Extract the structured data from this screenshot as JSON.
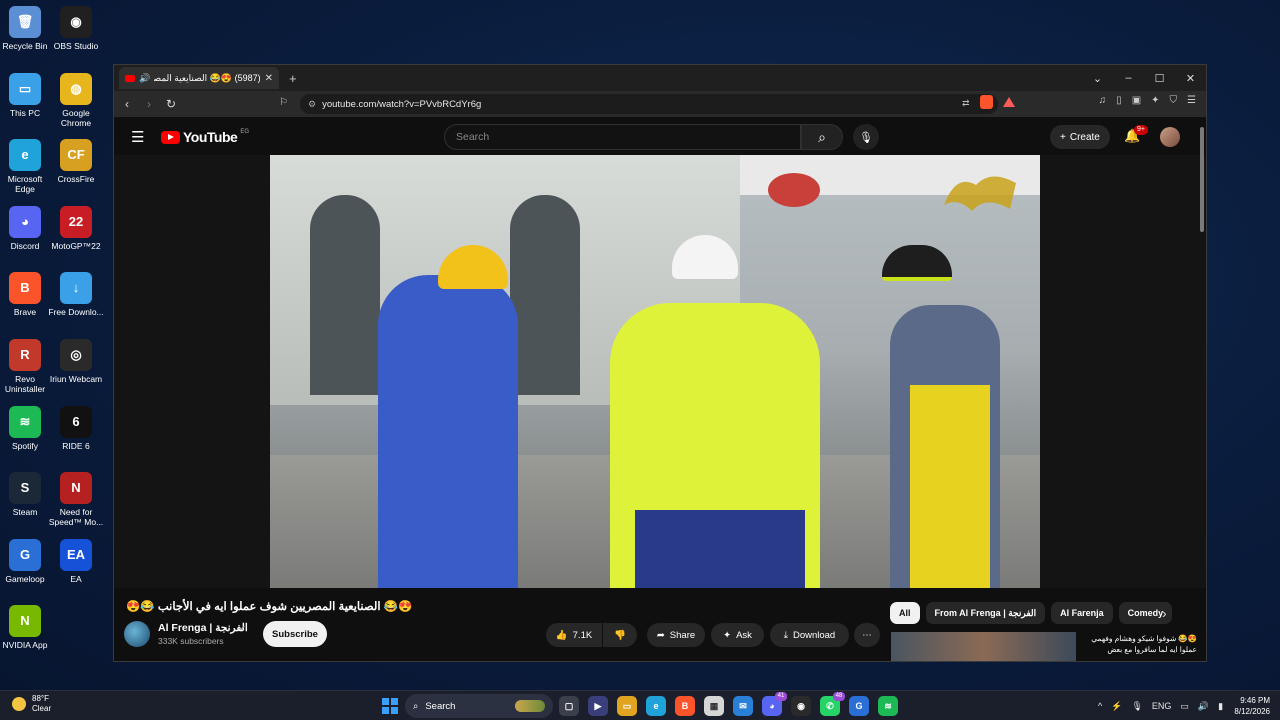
{
  "desktop": {
    "icons": [
      {
        "label": "Recycle Bin",
        "color": "#5b8fd4",
        "glyph": "🗑"
      },
      {
        "label": "OBS Studio",
        "color": "#202020",
        "glyph": "◉"
      },
      {
        "label": "This PC",
        "color": "#3aa0e8",
        "glyph": "▭"
      },
      {
        "label": "Google Chrome",
        "color": "#e7b51c",
        "glyph": "◍"
      },
      {
        "label": "Microsoft Edge",
        "color": "#1fa3d8",
        "glyph": "e"
      },
      {
        "label": "CrossFire",
        "color": "#d8a020",
        "glyph": "CF"
      },
      {
        "label": "Discord",
        "color": "#5865f2",
        "glyph": "◕"
      },
      {
        "label": "MotoGP™22",
        "color": "#c81d25",
        "glyph": "22"
      },
      {
        "label": "Brave",
        "color": "#fb542b",
        "glyph": "B"
      },
      {
        "label": "Free Downlo...",
        "color": "#3aa0e8",
        "glyph": "↓"
      },
      {
        "label": "Revo Uninstaller",
        "color": "#c0392b",
        "glyph": "R"
      },
      {
        "label": "Iriun Webcam",
        "color": "#2a2a2a",
        "glyph": "◎"
      },
      {
        "label": "Spotify",
        "color": "#1db954",
        "glyph": "≋"
      },
      {
        "label": "RIDE 6",
        "color": "#111111",
        "glyph": "6"
      },
      {
        "label": "Steam",
        "color": "#1b2838",
        "glyph": "S"
      },
      {
        "label": "Need for Speed™ Mo...",
        "color": "#b52020",
        "glyph": "N"
      },
      {
        "label": "Gameloop",
        "color": "#2a6fd6",
        "glyph": "G"
      },
      {
        "label": "EA",
        "color": "#1652d8",
        "glyph": "EA"
      },
      {
        "label": "NVIDIA App",
        "color": "#76b900",
        "glyph": "N"
      }
    ]
  },
  "browser": {
    "tab_title": "(5987) 😍😂 الصنايعية المصر",
    "new_tab": "+",
    "url": "youtube.com/watch?v=PVvbRCdYr6g",
    "window_controls": [
      "⌄",
      "–",
      "☐",
      "✕"
    ]
  },
  "youtube": {
    "logo_text": "YouTube",
    "country": "EG",
    "search_placeholder": "Search",
    "create_label": "Create",
    "notif_badge": "9+",
    "video_title": "😍😂 الصنايعية المصريين شوف عملوا ايه في الأجانب 😂😍",
    "channel_name": "Al Frenga | الفرنجة",
    "channel_subs": "333K subscribers",
    "subscribe_label": "Subscribe",
    "likes": "7.1K",
    "share_label": "Share",
    "ask_label": "Ask",
    "download_label": "Download",
    "more_label": "⋯",
    "chips": [
      "All",
      "From Al Frenga | الفرنجة",
      "Al Farenja",
      "Comedy"
    ],
    "rec_title": "😍😂 شوفوا شيكو وهشام وفهمي عملوا ايه لما سافروا مع بعض"
  },
  "taskbar": {
    "weather_temp": "88°F",
    "weather_desc": "Clear",
    "search_label": "Search",
    "lang": "ENG",
    "time": "9:46 PM",
    "date": "8/12/2026",
    "badges": [
      "41",
      "48"
    ]
  }
}
